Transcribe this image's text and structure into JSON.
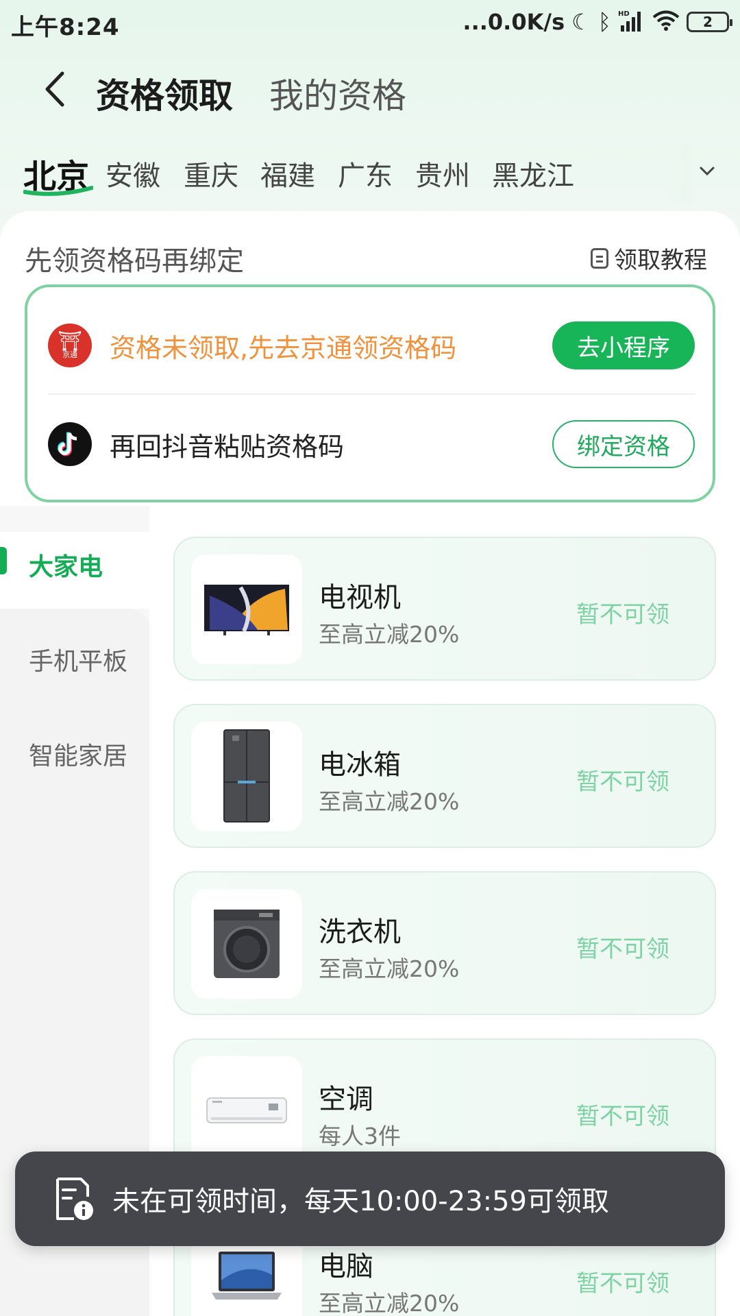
{
  "status_bar": {
    "time": "上午8:24",
    "net_speed": "...0.0K/s",
    "battery": "2",
    "icons": [
      "moon-icon",
      "bluetooth-icon",
      "hd-signal-icon",
      "wifi-icon",
      "battery-icon"
    ]
  },
  "header": {
    "title": "资格领取",
    "tab2": "我的资格"
  },
  "provinces": [
    "北京",
    "安徽",
    "重庆",
    "福建",
    "广东",
    "贵州",
    "黑龙江"
  ],
  "active_province": "北京",
  "section": {
    "title": "先领资格码再绑定",
    "tutorial_label": "领取教程"
  },
  "qualification": {
    "row1_text": "资格未领取,先去京通领资格码",
    "row1_button": "去小程序",
    "row1_logo_caption": "京通",
    "row2_text": "再回抖音粘贴资格码",
    "row2_button": "绑定资格"
  },
  "categories": [
    "大家电",
    "手机平板",
    "智能家居"
  ],
  "active_category": "大家电",
  "products": [
    {
      "name": "电视机",
      "sub": "至高立减20%",
      "status": "暂不可领",
      "icon": "tv-image"
    },
    {
      "name": "电冰箱",
      "sub": "至高立减20%",
      "status": "暂不可领",
      "icon": "fridge-image"
    },
    {
      "name": "洗衣机",
      "sub": "至高立减20%",
      "status": "暂不可领",
      "icon": "washer-image"
    },
    {
      "name": "空调",
      "sub": "每人3件",
      "status": "暂不可领",
      "icon": "aircon-image"
    },
    {
      "name": "电脑",
      "sub": "至高立减20%",
      "status": "暂不可领",
      "icon": "laptop-image"
    }
  ],
  "toast": {
    "text": "未在可领时间，每天10:00-23:59可领取"
  },
  "colors": {
    "brand_green": "#14ad55",
    "orange_text": "#f0923b",
    "disabled_green": "#7dd3a3",
    "toast_bg": "#45464c"
  }
}
